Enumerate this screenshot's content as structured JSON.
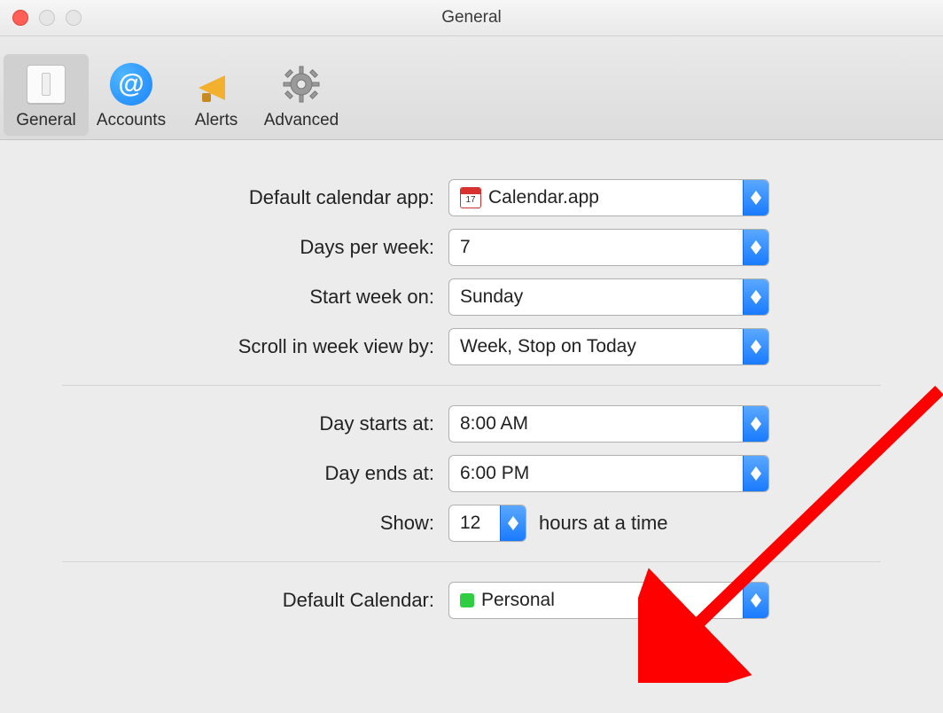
{
  "window_title": "General",
  "toolbar": {
    "items": [
      {
        "label": "General",
        "active": true
      },
      {
        "label": "Accounts",
        "active": false
      },
      {
        "label": "Alerts",
        "active": false
      },
      {
        "label": "Advanced",
        "active": false
      }
    ]
  },
  "settings": {
    "default_app": {
      "label": "Default calendar app:",
      "value": "Calendar.app"
    },
    "days_per_week": {
      "label": "Days per week:",
      "value": "7"
    },
    "start_week_on": {
      "label": "Start week on:",
      "value": "Sunday"
    },
    "scroll_week_by": {
      "label": "Scroll in week view by:",
      "value": "Week, Stop on Today"
    },
    "day_starts": {
      "label": "Day starts at:",
      "value": "8:00 AM"
    },
    "day_ends": {
      "label": "Day ends at:",
      "value": "6:00 PM"
    },
    "show": {
      "label": "Show:",
      "value": "12",
      "suffix": "hours at a time"
    },
    "default_calendar": {
      "label": "Default Calendar:",
      "value": "Personal",
      "color": "#2fcd41"
    }
  }
}
